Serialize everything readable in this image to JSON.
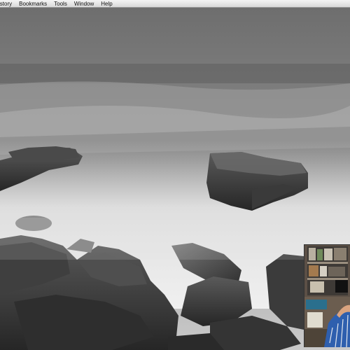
{
  "menubar": {
    "items": [
      {
        "label": "istory"
      },
      {
        "label": "Bookmarks"
      },
      {
        "label": "Tools"
      },
      {
        "label": "Window"
      },
      {
        "label": "Help"
      }
    ]
  },
  "desktop": {
    "wallpaper_icon": "long-exposure-seascape-image"
  },
  "webcam": {
    "icon": "webcam-video-feed"
  }
}
